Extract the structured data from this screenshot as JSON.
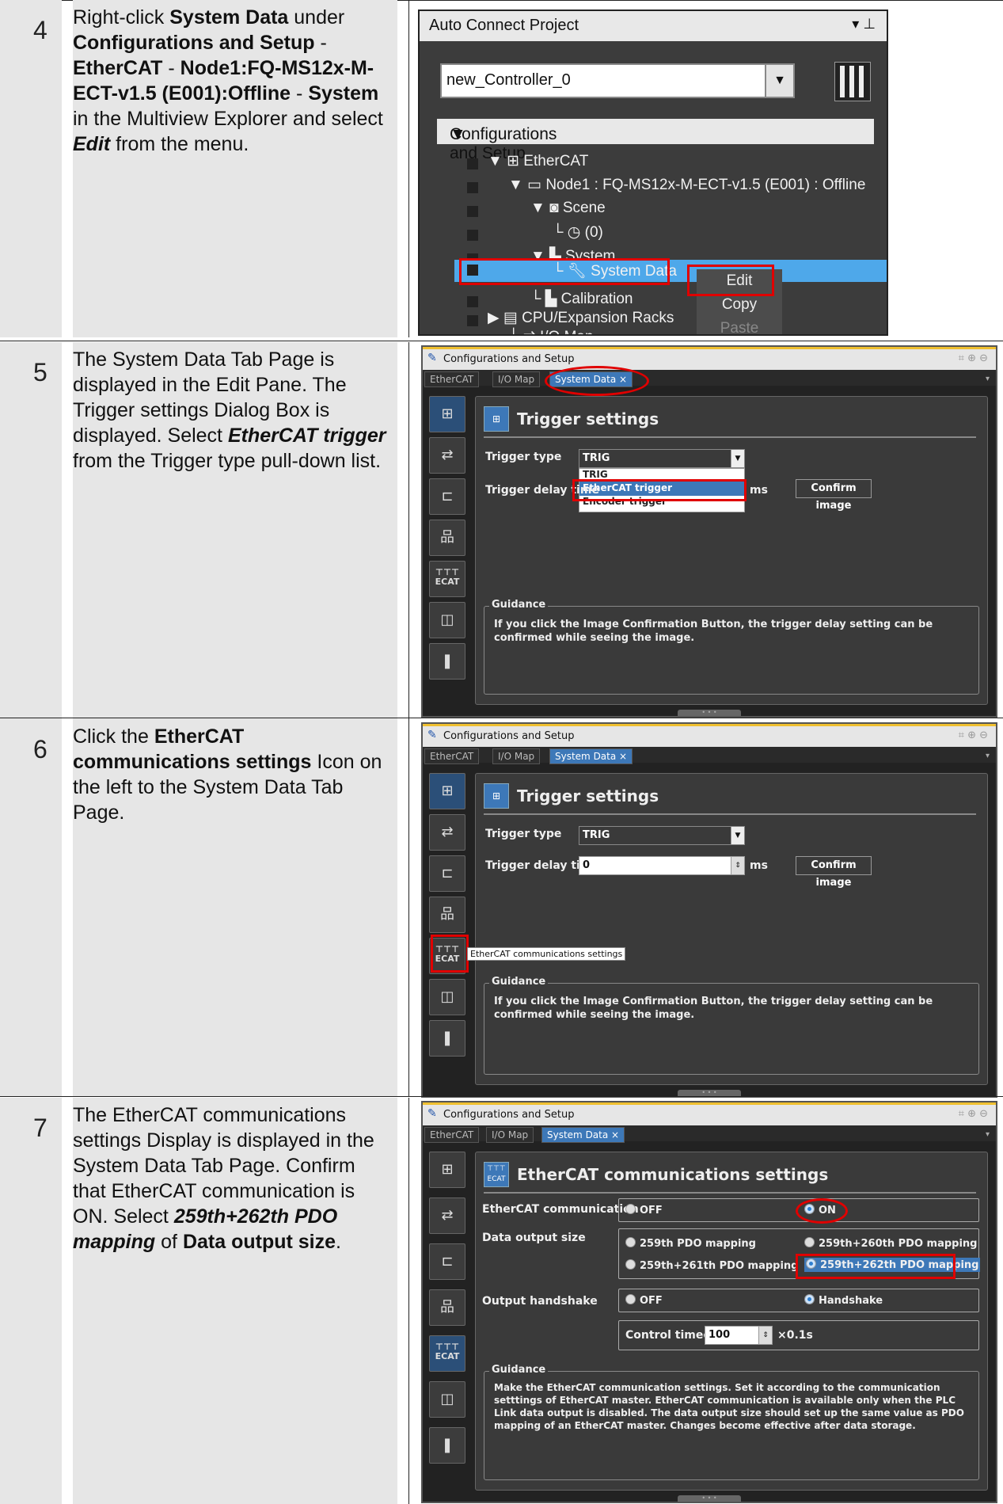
{
  "steps": [
    {
      "number": "4"
    },
    {
      "number": "5",
      "text": "The System Data Tab Page is displayed in the Edit Pane. The Trigger settings Dialog Box is displayed. Select",
      "em": "EtherCAT trigger",
      "tail": "from the Trigger type pull-down list."
    },
    {
      "number": "6",
      "pre": "Click the",
      "bold": "EtherCAT communications settings",
      "tail": "Icon on the left to the System Data Tab Page."
    },
    {
      "number": "7",
      "text": "The EtherCAT communications settings Display is displayed in the System Data Tab Page. Confirm that EtherCAT communication is ON. Select",
      "em": "259th+262th PDO mapping",
      "of": "of",
      "bold": "Data output size",
      "end": "."
    }
  ],
  "step4": {
    "p1": "Right-click",
    "b1": "System Data",
    "p2": "under",
    "b2": "Configurations and Setup",
    "p3": "-",
    "b3": "EtherCAT",
    "p4": "-",
    "b4": "Node1:FQ-MS12x-M-ECT-v1.5 (E001):Offline",
    "p5": "-",
    "b5": "System",
    "p6": "in the Multiview Explorer and select",
    "em": "Edit",
    "p7": "from the menu."
  },
  "explorer": {
    "title": "Auto Connect Project",
    "controller": "new_Controller_0",
    "root": "Configurations and Setup",
    "tree": [
      "EtherCAT",
      "Node1 : FQ-MS12x-M-ECT-v1.5 (E001) : Offline",
      "Scene",
      "(0)",
      "System",
      "System Data",
      "Calibration",
      "CPU/Expansion Racks",
      "I/O Map"
    ],
    "menu": [
      "Edit",
      "Copy",
      "Paste"
    ]
  },
  "tabpage": {
    "title": "Configurations and Setup",
    "tabs": [
      "EtherCAT",
      "I/O Map",
      "System Data"
    ],
    "trigger": {
      "heading": "Trigger settings",
      "type_label": "Trigger type",
      "type_value": "TRIG",
      "delay_label": "Trigger delay time",
      "delay_value": "0",
      "unit": "ms",
      "confirm": "Confirm image",
      "options": [
        "TRIG",
        "EtherCAT trigger",
        "Encoder trigger"
      ],
      "guidance_label": "Guidance",
      "guidance": "If you click the Image Confirmation Button, the trigger delay setting can be confirmed while seeing the image.",
      "tooltip": "EtherCAT communications settings"
    },
    "ecat": {
      "heading": "EtherCAT communications settings",
      "comm_label": "EtherCAT communication",
      "off": "OFF",
      "on": "ON",
      "size_label": "Data output size",
      "opt1": "259th PDO mapping",
      "opt2": "259th+260th PDO mapping",
      "opt3": "259th+261th PDO mapping",
      "opt4": "259th+262th PDO mapping",
      "hs_label": "Output handshake",
      "hs_off": "OFF",
      "hs_on": "Handshake",
      "timeout_label": "Control timeout",
      "timeout_value": "100",
      "timeout_unit": "×0.1s",
      "guidance_label": "Guidance",
      "guidance": "Make the EtherCAT communication settings. Set it according to the communication setttings of EtherCAT master. EtherCAT communication is available only when the PLC Link data output is disabled. The data output size should set up the same value as PDO mapping of an EtherCAT master. Changes become effective after data storage."
    }
  },
  "colors": {
    "highlight": "#e00000",
    "select": "#4ea8ea",
    "tab_active": "#3d78b8"
  }
}
